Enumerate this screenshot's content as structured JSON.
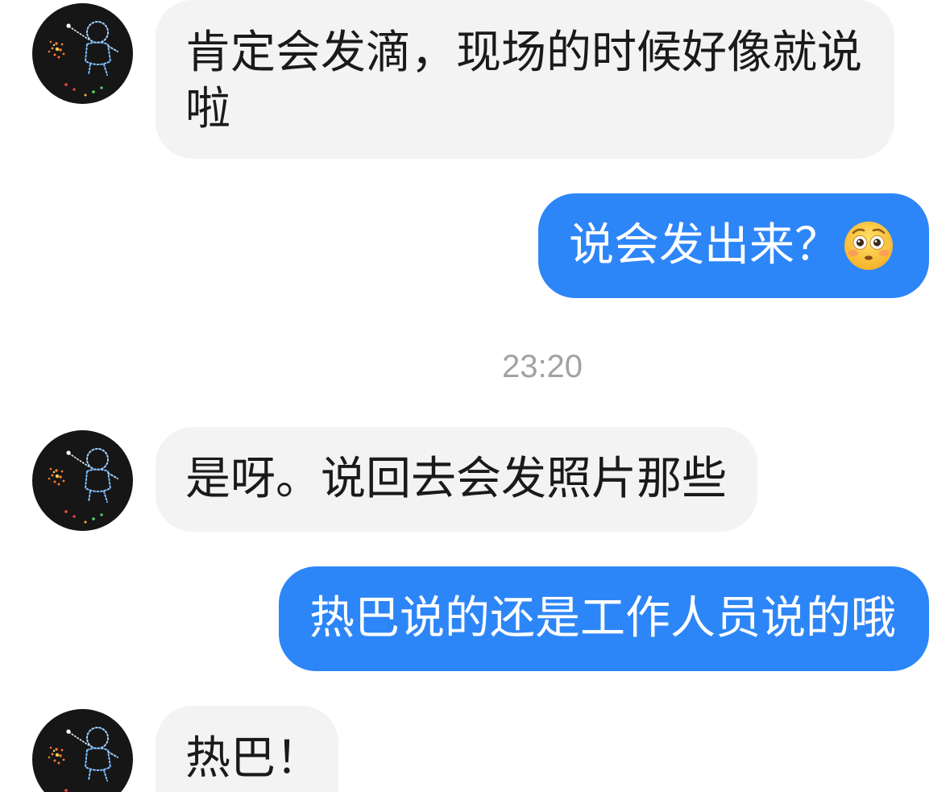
{
  "colors": {
    "background": "#ffffff",
    "incoming_bubble": "#f3f3f3",
    "outgoing_bubble": "#2d86f7",
    "incoming_text": "#1a1a1a",
    "outgoing_text": "#ffffff",
    "timestamp": "#a2a2a2"
  },
  "avatar_icon": "drone-light-show-avatar",
  "thread": {
    "incoming_1": {
      "text": "肯定会发滴，现场的时候好像就说啦"
    },
    "outgoing_1": {
      "text": "说会发出来？",
      "emoji_icon": "flushed-face"
    },
    "timestamp": "23:20",
    "incoming_2": {
      "text": "是呀。说回去会发照片那些"
    },
    "outgoing_2": {
      "text": "热巴说的还是工作人员说的哦"
    },
    "incoming_3": {
      "text": "热巴！"
    }
  }
}
